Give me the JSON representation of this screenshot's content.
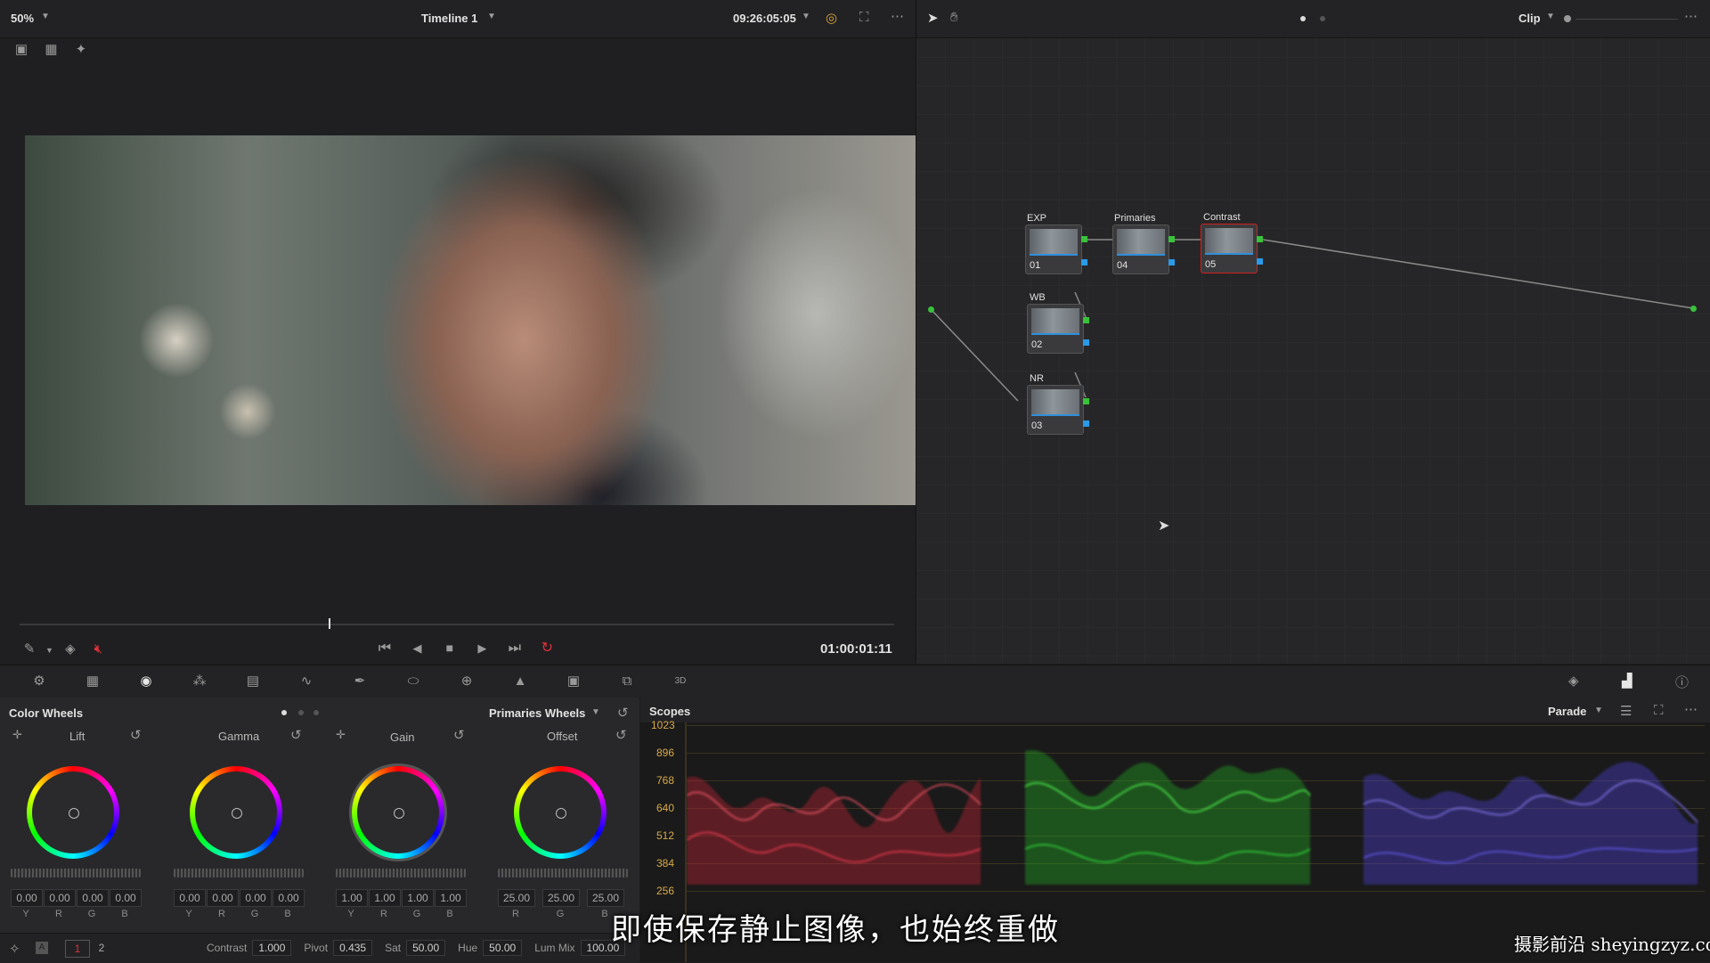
{
  "viewer": {
    "zoom": "50%",
    "timeline_name": "Timeline 1",
    "source_timecode": "09:26:05:05",
    "record_timecode": "01:00:01:11",
    "mode_label": "Clip"
  },
  "nodes": [
    {
      "label": "EXP",
      "num": "01"
    },
    {
      "label": "Primaries",
      "num": "04"
    },
    {
      "label": "Contrast",
      "num": "05"
    },
    {
      "label": "WB",
      "num": "02"
    },
    {
      "label": "NR",
      "num": "03"
    }
  ],
  "color_wheels": {
    "title": "Color Wheels",
    "mode": "Primaries Wheels",
    "wheels": [
      {
        "name": "Lift",
        "values": [
          "0.00",
          "0.00",
          "0.00",
          "0.00"
        ],
        "channels": [
          "Y",
          "R",
          "G",
          "B"
        ]
      },
      {
        "name": "Gamma",
        "values": [
          "0.00",
          "0.00",
          "0.00",
          "0.00"
        ],
        "channels": [
          "Y",
          "R",
          "G",
          "B"
        ]
      },
      {
        "name": "Gain",
        "values": [
          "1.00",
          "1.00",
          "1.00",
          "1.00"
        ],
        "channels": [
          "Y",
          "R",
          "G",
          "B"
        ]
      },
      {
        "name": "Offset",
        "values": [
          "25.00",
          "25.00",
          "25.00"
        ],
        "channels": [
          "R",
          "G",
          "B"
        ]
      }
    ],
    "page_numbers": [
      "1",
      "2"
    ],
    "fields": [
      {
        "label": "Contrast",
        "value": "1.000"
      },
      {
        "label": "Pivot",
        "value": "0.435"
      },
      {
        "label": "Sat",
        "value": "50.00"
      },
      {
        "label": "Hue",
        "value": "50.00"
      },
      {
        "label": "Lum Mix",
        "value": "100.00"
      }
    ]
  },
  "scopes": {
    "title": "Scopes",
    "mode": "Parade",
    "y_ticks": [
      "1023",
      "896",
      "768",
      "640",
      "512",
      "384",
      "256"
    ]
  },
  "subtitle": "即使保存静止图像，也始终重做",
  "watermark": "摄影前沿 sheyingzyz.com",
  "colors": {
    "accent_red": "#e0303a",
    "ring_red": "#d02020",
    "green": "#39c23a",
    "blue": "#2b9ae8"
  }
}
